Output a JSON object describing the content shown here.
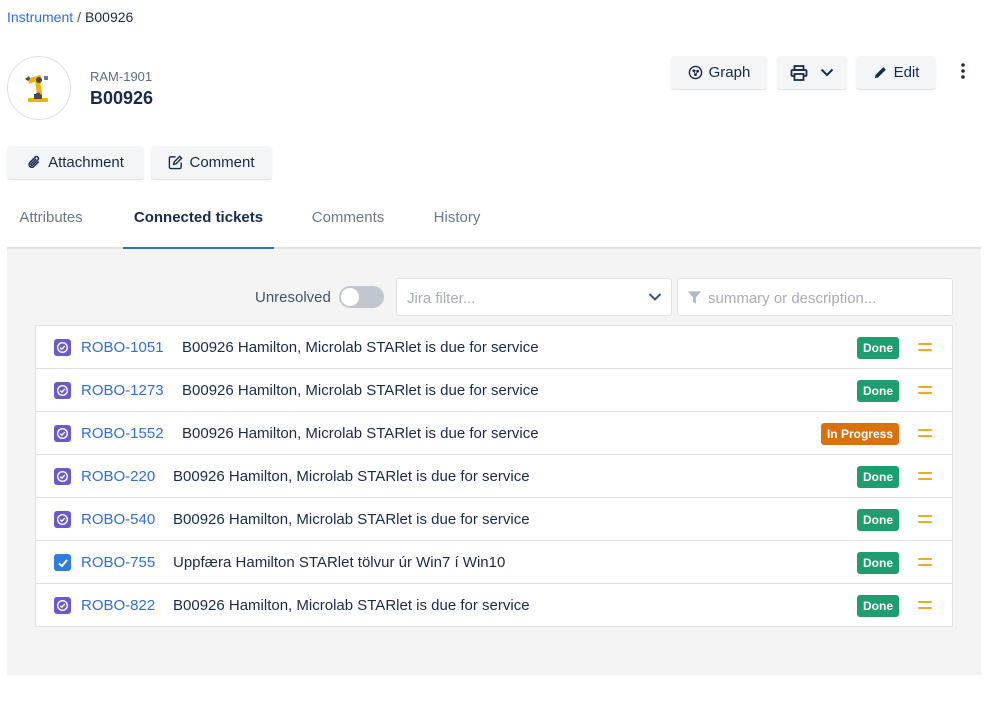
{
  "breadcrumb": {
    "parent": "Instrument",
    "separator": "/",
    "current": "B00926"
  },
  "header": {
    "key": "RAM-1901",
    "name": "B00926"
  },
  "toolbar": {
    "graph_label": "Graph",
    "edit_label": "Edit"
  },
  "actions": {
    "attachment_label": "Attachment",
    "comment_label": "Comment"
  },
  "tabs": [
    {
      "label": "Attributes",
      "active": false
    },
    {
      "label": "Connected tickets",
      "active": true
    },
    {
      "label": "Comments",
      "active": false
    },
    {
      "label": "History",
      "active": false
    }
  ],
  "filters": {
    "unresolved_label": "Unresolved",
    "unresolved_on": false,
    "jira_placeholder": "Jira filter...",
    "search_placeholder": "summary or description..."
  },
  "colors": {
    "link": "#2f6fd6",
    "done": "#1e9e6e",
    "in_progress": "#d9720e",
    "priority_medium": "#f5a623"
  },
  "tickets": [
    {
      "type": "task-icon",
      "key": "ROBO-1051",
      "summary": "B00926 Hamilton, Microlab STARlet is due for service",
      "status": "Done"
    },
    {
      "type": "task-icon",
      "key": "ROBO-1273",
      "summary": "B00926 Hamilton, Microlab STARlet is due for service",
      "status": "Done"
    },
    {
      "type": "task-icon",
      "key": "ROBO-1552",
      "summary": "B00926 Hamilton, Microlab STARlet is due for service",
      "status": "In Progress"
    },
    {
      "type": "task-icon",
      "key": "ROBO-220",
      "summary": "B00926 Hamilton, Microlab STARlet is due for service",
      "status": "Done"
    },
    {
      "type": "task-icon",
      "key": "ROBO-540",
      "summary": "B00926 Hamilton, Microlab STARlet is due for service",
      "status": "Done"
    },
    {
      "type": "checkbox-icon",
      "key": "ROBO-755",
      "summary": "Uppfæra Hamilton STARlet tölvur úr Win7 í Win10",
      "status": "Done"
    },
    {
      "type": "task-icon",
      "key": "ROBO-822",
      "summary": "B00926 Hamilton, Microlab STARlet is due for service",
      "status": "Done"
    }
  ]
}
